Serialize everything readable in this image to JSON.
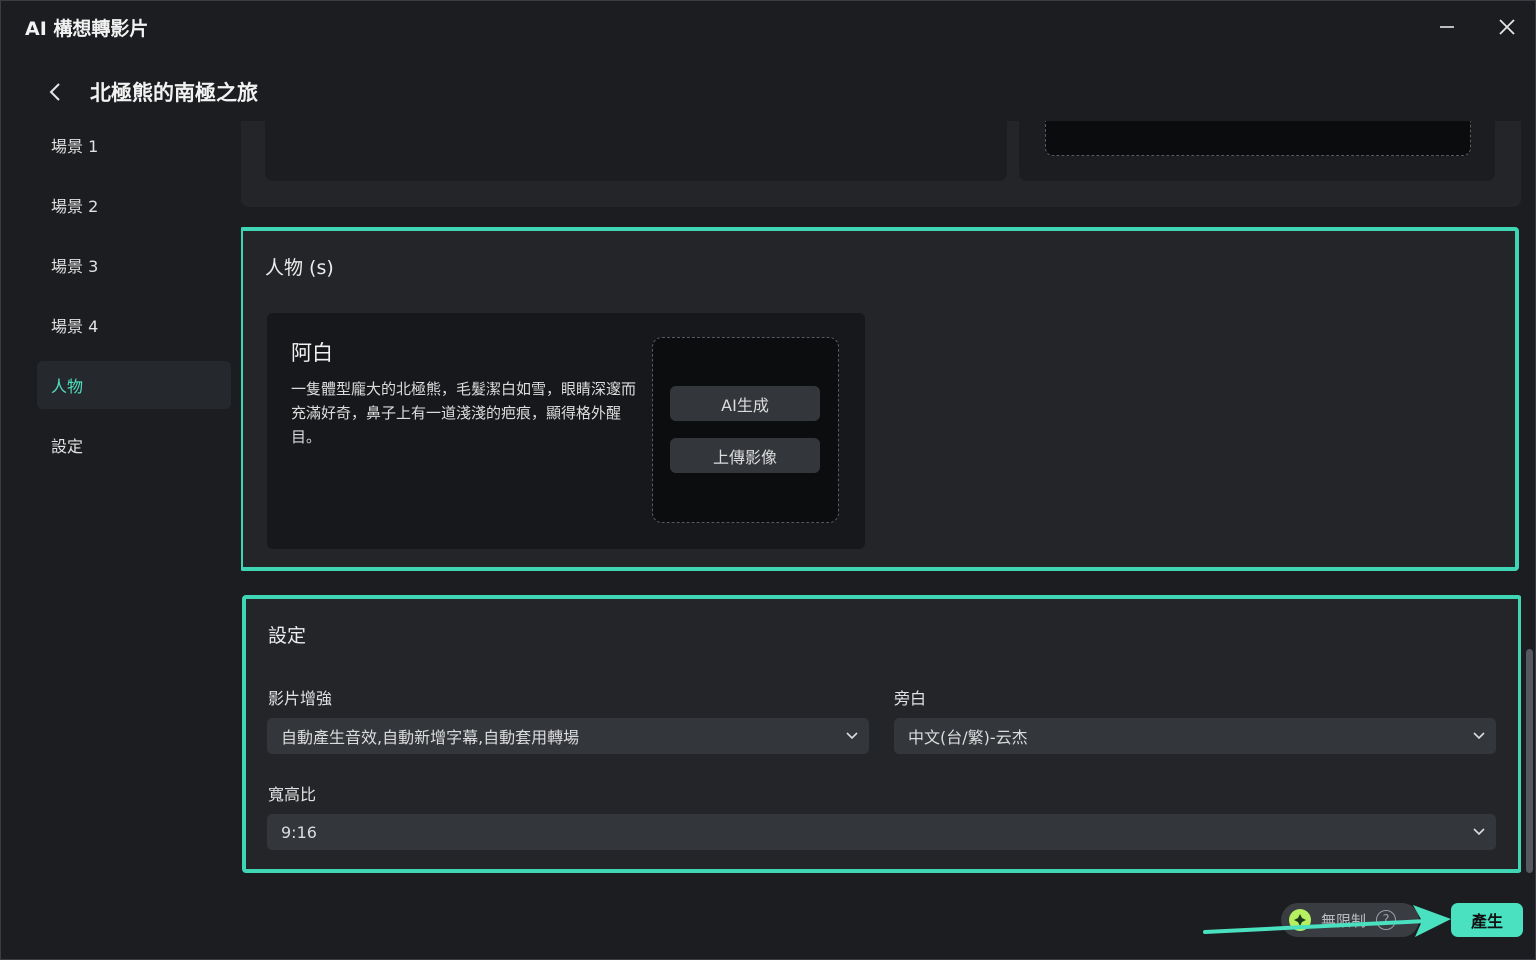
{
  "window": {
    "title": "AI 構想轉影片"
  },
  "header": {
    "title": "北極熊的南極之旅"
  },
  "sidebar": {
    "items": [
      {
        "label": "場景 1",
        "active": false
      },
      {
        "label": "場景 2",
        "active": false
      },
      {
        "label": "場景 3",
        "active": false
      },
      {
        "label": "場景 4",
        "active": false
      },
      {
        "label": "人物",
        "active": true
      },
      {
        "label": "設定",
        "active": false
      }
    ]
  },
  "characters": {
    "title": "人物 (s)",
    "items": [
      {
        "name": "阿白",
        "description": "一隻體型龐大的北極熊，毛髮潔白如雪，眼睛深邃而充滿好奇，鼻子上有一道淺淺的疤痕，顯得格外醒目。",
        "ai_generate_label": "AI生成",
        "upload_label": "上傳影像"
      }
    ]
  },
  "settings": {
    "title": "設定",
    "enhance": {
      "label": "影片增強",
      "value": "自動產生音效,自動新增字幕,自動套用轉場"
    },
    "narration": {
      "label": "旁白",
      "value": "中文(台/繁)-云杰"
    },
    "aspect": {
      "label": "寬高比",
      "value": "9:16"
    }
  },
  "footer": {
    "plan_label": "無限制",
    "help_symbol": "?",
    "generate_label": "產生"
  },
  "colors": {
    "accent": "#49e1bf",
    "highlight_border": "#3ed6b5",
    "gem": "#b6f061"
  }
}
